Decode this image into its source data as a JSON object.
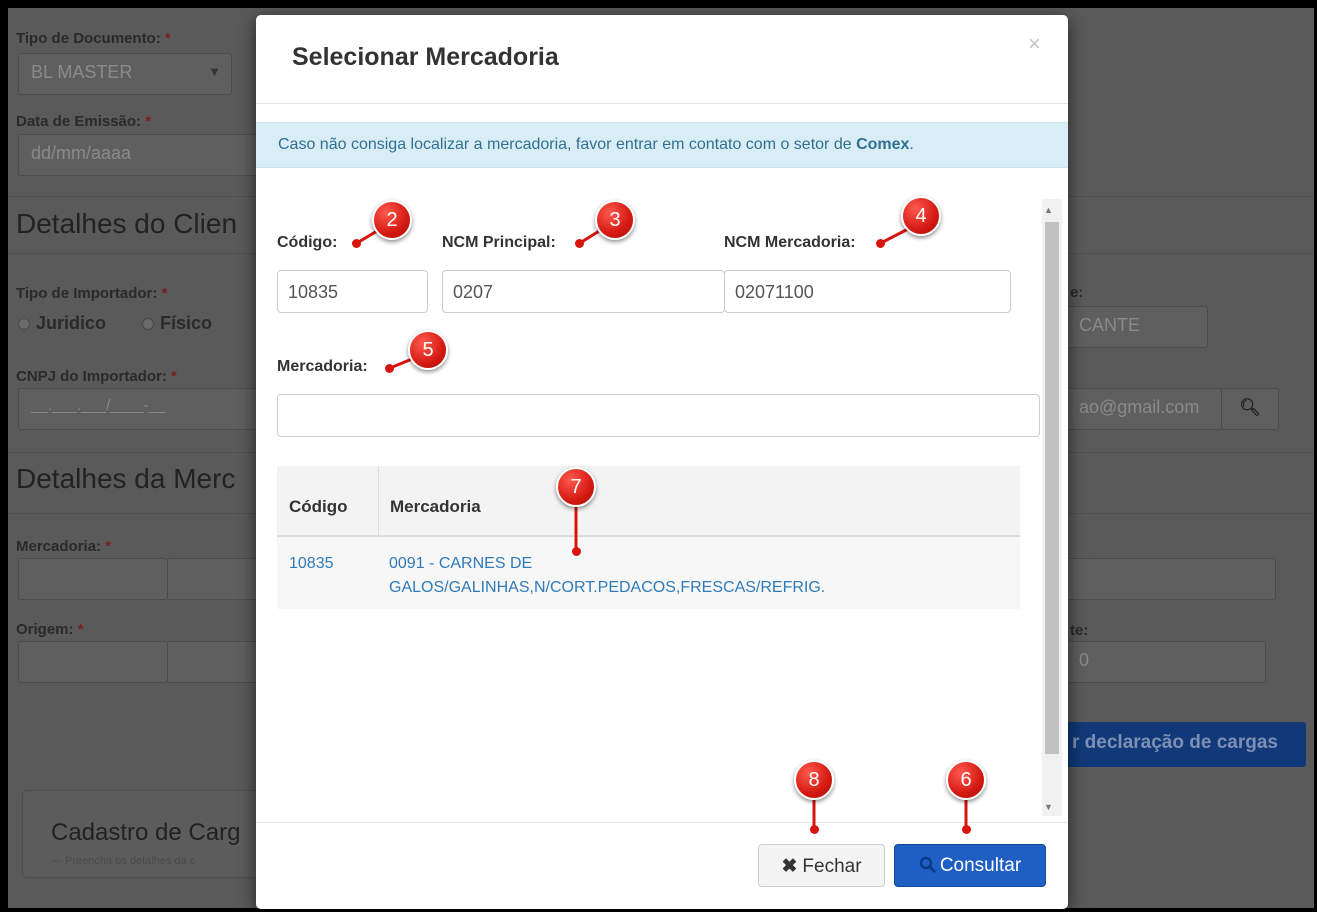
{
  "background": {
    "tipo_documento_label": "Tipo de Documento:",
    "tipo_documento_value": "BL MASTER",
    "data_emissao_label": "Data de Emissão:",
    "data_emissao_placeholder": "dd/mm/aaaa",
    "detalhes_cliente_heading": "Detalhes do Clien",
    "tipo_importador_label": "Tipo de Importador:",
    "radio_juridico": "Juridico",
    "radio_fisico": "Físico",
    "cnpj_label": "CNPJ do Importador:",
    "cnpj_placeholder": "__.___.___/____-__",
    "detalhes_mercadoria_heading": "Detalhes da Merc",
    "mercadoria_label": "Mercadoria:",
    "origem_label": "Origem:",
    "right_label_1": "e:",
    "right_value_1": "CANTE",
    "right_email": "ao@gmail.com",
    "right_label_2": "te:",
    "right_value_2": "0",
    "action_button": "r declaração de cargas",
    "cadastro_heading": "Cadastro de Carg",
    "cadastro_sub": "— Preencha os detalhes da c",
    "required_mark": "*"
  },
  "modal": {
    "title": "Selecionar Mercadoria",
    "close_glyph": "×",
    "alert_text": "Caso não consiga localizar a mercadoria, favor entrar em contato com o setor de ",
    "alert_strong": "Comex",
    "alert_end": ".",
    "codigo_label": "Código:",
    "codigo_value": "10835",
    "ncm_principal_label": "NCM Principal:",
    "ncm_principal_value": "0207",
    "ncm_mercadoria_label": "NCM Mercadoria:",
    "ncm_mercadoria_value": "02071100",
    "mercadoria_label": "Mercadoria:",
    "mercadoria_value": "",
    "table": {
      "headers": [
        "Código",
        "Mercadoria"
      ],
      "rows": [
        {
          "codigo": "10835",
          "mercadoria_line1": "0091 - CARNES DE",
          "mercadoria_line2": "GALOS/GALINHAS,N/CORT.PEDACOS,FRESCAS/REFRIG."
        }
      ]
    },
    "fechar_label": "Fechar",
    "consultar_label": "Consultar"
  },
  "markers": [
    "2",
    "3",
    "4",
    "5",
    "7",
    "8",
    "6"
  ],
  "colors": {
    "marker": "#d8140f",
    "primary": "#1f5fc4",
    "link": "#2f7ab8",
    "alert_bg": "#d9edf7"
  }
}
